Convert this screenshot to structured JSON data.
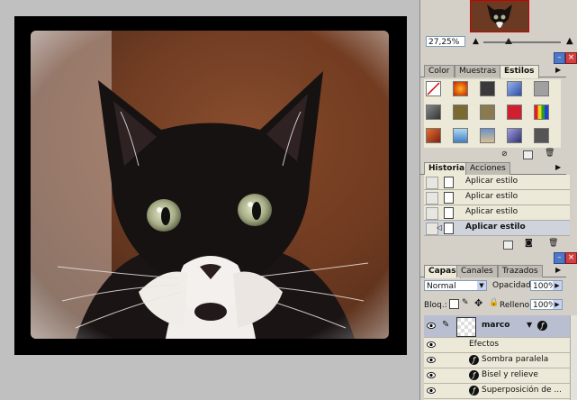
{
  "navigator": {
    "zoom_value": "27,25%"
  },
  "styles_panel": {
    "tabs": [
      {
        "label": "Color",
        "active": false
      },
      {
        "label": "Muestras",
        "active": false
      },
      {
        "label": "Estilos",
        "active": true
      }
    ]
  },
  "history_panel": {
    "tabs": [
      {
        "label": "Historia",
        "active": true
      },
      {
        "label": "Acciones",
        "active": false
      }
    ],
    "items": [
      {
        "label": "Aplicar estilo",
        "current": false
      },
      {
        "label": "Aplicar estilo",
        "current": false
      },
      {
        "label": "Aplicar estilo",
        "current": false
      },
      {
        "label": "Aplicar estilo",
        "current": true
      }
    ]
  },
  "layers_panel": {
    "tabs": [
      {
        "label": "Capas",
        "active": true
      },
      {
        "label": "Canales",
        "active": false
      },
      {
        "label": "Trazados",
        "active": false
      }
    ],
    "blend_mode": "Normal",
    "opacity_label": "Opacidad:",
    "opacity_value": "100%",
    "lock_label": "Bloq.:",
    "fill_label": "Relleno:",
    "fill_value": "100%",
    "layer_name": "marco",
    "effects_label": "Efectos",
    "effects": [
      "Sombra paralela",
      "Bisel y relieve",
      "Superposición de ..."
    ]
  }
}
